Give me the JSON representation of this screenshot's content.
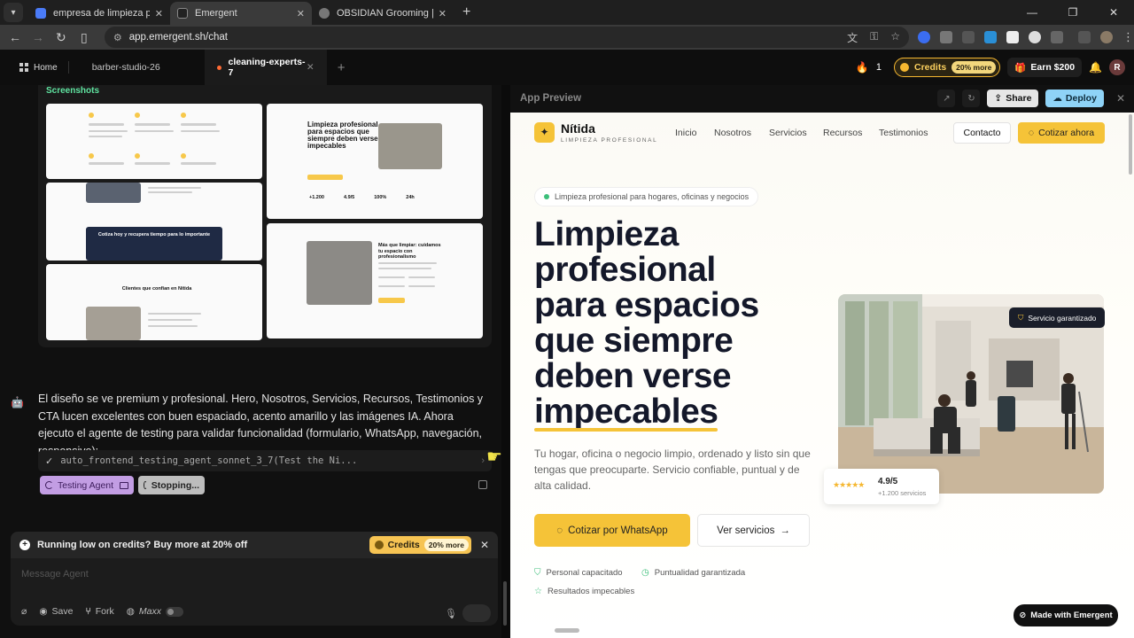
{
  "browser": {
    "tabs": [
      {
        "title": "empresa de limpieza profesiona",
        "active": false,
        "favicon_color": "#4a7bf7"
      },
      {
        "title": "Emergent",
        "active": true,
        "favicon_color": "#222222"
      },
      {
        "title": "OBSIDIAN Grooming | Barbería",
        "active": false,
        "favicon_color": "#777777"
      }
    ],
    "url": "app.emergent.sh/chat"
  },
  "app": {
    "home_label": "Home",
    "tabs": [
      {
        "label": "barber-studio-26",
        "active": false
      },
      {
        "label": "cleaning-experts-7",
        "active": true
      }
    ],
    "fire_count": "1",
    "credits_label": "Credits",
    "credits_badge": "20% more",
    "earn_label": "Earn $200",
    "avatar_initial": "R"
  },
  "chat": {
    "screenshots_title": "Screenshots",
    "thumbs": {
      "t2_headline": "Limpieza profesional para espacios que siempre deben verse impecables",
      "t2_stats": [
        "+1.200",
        "4.9/5",
        "100%",
        "24h"
      ],
      "t3_banner": "Cotiza hoy y recupera tiempo para lo importante",
      "t4_heading": "Más que limpiar: cuidamos tu espacio con profesionalismo",
      "t5_heading": "Clientes que confían en Nítida"
    },
    "agent_message": "El diseño se ve premium y profesional. Hero, Nosotros, Servicios, Recursos, Testimonios y CTA lucen excelentes con buen espaciado, acento amarillo y las imágenes IA. Ahora ejecuto el agente de testing para validar funcionalidad (formulario, WhatsApp, navegación, responsive):",
    "tool_call": "auto_frontend_testing_agent_sonnet_3_7(Test the Ni...",
    "testing_pill": "Testing Agent",
    "stopping_pill": "Stopping...",
    "low_credits_text": "Running low on credits? Buy more at 20% off",
    "credits_label": "Credits",
    "credits_badge": "20% more",
    "composer_placeholder": "Message Agent",
    "tool_save": "Save",
    "tool_fork": "Fork",
    "tool_maxx": "Maxx"
  },
  "preview": {
    "title": "App Preview",
    "share_label": "Share",
    "deploy_label": "Deploy",
    "site": {
      "brand": "Nítida",
      "brand_sub": "LIMPIEZA PROFESIONAL",
      "nav": [
        "Inicio",
        "Nosotros",
        "Servicios",
        "Recursos",
        "Testimonios"
      ],
      "contact_label": "Contacto",
      "quote_label": "Cotizar ahora",
      "badge": "Limpieza profesional para hogares, oficinas y negocios",
      "hero_lines": [
        "Limpieza",
        "profesional",
        "para espacios",
        "que siempre",
        "deben verse"
      ],
      "hero_highlight": "impecables",
      "hero_sub": "Tu hogar, oficina o negocio limpio, ordenado y listo sin que tengas que preocuparte. Servicio confiable, puntual y de alta calidad.",
      "cta_whatsapp": "Cotizar por WhatsApp",
      "cta_services": "Ver servicios",
      "features": [
        "Personal capacitado",
        "Puntualidad garantizada",
        "Resultados impecables"
      ],
      "guarantee_badge": "Servicio garantizado",
      "rating_value": "4.9/5",
      "rating_count": "+1.200 servicios",
      "rating_stars": 5
    },
    "made_with": "Made with Emergent"
  },
  "colors": {
    "accent_yellow": "#f5c338",
    "credits_border": "#f5b730",
    "screenshot_title_green": "#5fe3a0",
    "testing_purple": "#c29de3",
    "deploy_blue": "#8fd3f7"
  }
}
